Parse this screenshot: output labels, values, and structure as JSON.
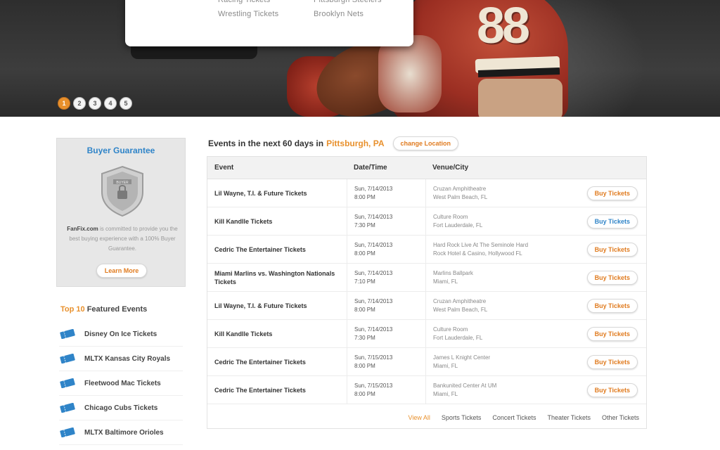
{
  "hero": {
    "dropdown": {
      "col1": [
        "Racing Tickets",
        "Wrestling Tickets"
      ],
      "col2": [
        "Pittsburgh Steelers",
        "Brooklyn Nets"
      ]
    },
    "jersey_number": "88",
    "slider_dots": [
      "1",
      "2",
      "3",
      "4",
      "5"
    ],
    "active_dot": 0
  },
  "sidebar": {
    "guarantee": {
      "title": "Buyer Guarantee",
      "badge_text": "BUYER",
      "site": "FanFix.com",
      "text": " is committed to provide you the best buying experience with a 100% Buyer Guarantee.",
      "button": "Learn More"
    },
    "featured": {
      "title_highlight": "Top 10",
      "title_rest": " Featured Events",
      "items": [
        "Disney On Ice Tickets",
        "MLTX Kansas City Royals",
        "Fleetwood Mac Tickets",
        "Chicago Cubs Tickets",
        "MLTX Baltimore Orioles"
      ]
    }
  },
  "events": {
    "header_label": "Events in the next 60 days in",
    "location": "Pittsburgh, PA",
    "change_location": "change Location",
    "columns": [
      "Event",
      "Date/Time",
      "Venue/City"
    ],
    "buy_label": "Buy Tickets",
    "rows": [
      {
        "event": "Lil Wayne, T.I. & Future Tickets",
        "date": "Sun, 7/14/2013",
        "time": "8:00 PM",
        "venue": "Cruzan Amphitheatre",
        "city": "West Palm Beach, FL",
        "buy_color": "#e07b1f"
      },
      {
        "event": "Kill Kandlle Tickets",
        "date": "Sun, 7/14/2013",
        "time": "7:30 PM",
        "venue": "Culture Room",
        "city": "Fort Lauderdale, FL",
        "buy_color": "#2f84c8"
      },
      {
        "event": "Cedric The Entertainer Tickets",
        "date": "Sun, 7/14/2013",
        "time": "8:00 PM",
        "venue": "Hard Rock Live At The Seminole Hard",
        "city": "Rock Hotel & Casino, Hollywood FL",
        "buy_color": "#e07b1f"
      },
      {
        "event": "Miami Marlins vs. Washington Nationals Tickets",
        "date": "Sun, 7/14/2013",
        "time": "7:10 PM",
        "venue": "Marlins Ballpark",
        "city": "Miami, FL",
        "buy_color": "#e07b1f"
      },
      {
        "event": "Lil Wayne, T.I. & Future Tickets",
        "date": "Sun, 7/14/2013",
        "time": "8:00 PM",
        "venue": "Cruzan Amphitheatre",
        "city": "West Palm Beach, FL",
        "buy_color": "#e07b1f"
      },
      {
        "event": "Kill Kandlle Tickets",
        "date": "Sun, 7/14/2013",
        "time": "7:30 PM",
        "venue": "Culture Room",
        "city": "Fort Lauderdale, FL",
        "buy_color": "#e07b1f"
      },
      {
        "event": "Cedric The Entertainer Tickets",
        "date": "Sun, 7/15/2013",
        "time": "8:00 PM",
        "venue": "James L Knight Center",
        "city": "Miami, FL",
        "buy_color": "#e07b1f"
      },
      {
        "event": "Cedric The Entertainer Tickets",
        "date": "Sun, 7/15/2013",
        "time": "8:00 PM",
        "venue": "Bankunited Center At UM",
        "city": "Miami, FL",
        "buy_color": "#e07b1f"
      }
    ],
    "footer_links": [
      "View All",
      "Sports Tickets",
      "Concert Tickets",
      "Theater Tickets",
      "Other Tickets"
    ]
  },
  "colors": {
    "accent_orange": "#e8902c",
    "accent_blue": "#2f84c8"
  }
}
